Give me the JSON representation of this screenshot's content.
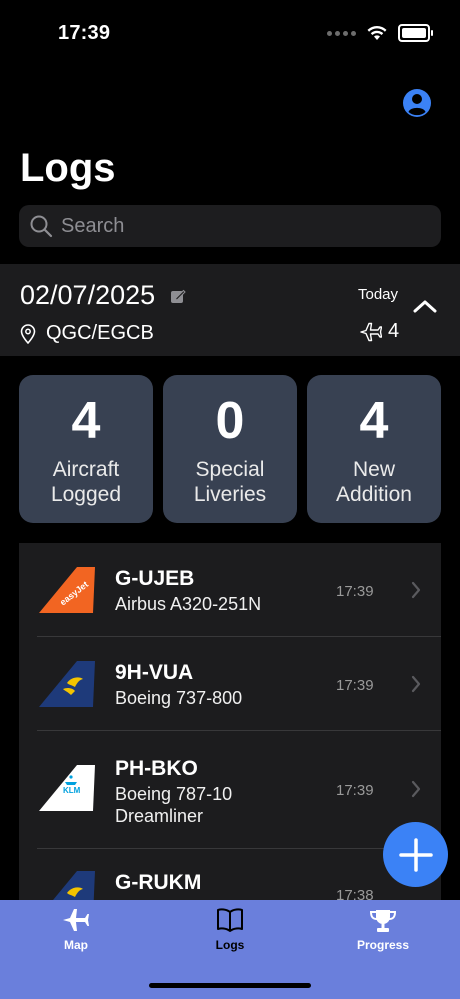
{
  "status_bar": {
    "time": "17:39"
  },
  "header": {
    "title": "Logs"
  },
  "search": {
    "placeholder": "Search"
  },
  "session": {
    "date": "02/07/2025",
    "location": "QGC/EGCB",
    "day_label": "Today",
    "aircraft_count": "4"
  },
  "stats": [
    {
      "value": "4",
      "label_line1": "Aircraft",
      "label_line2": "Logged"
    },
    {
      "value": "0",
      "label_line1": "Special",
      "label_line2": "Liveries"
    },
    {
      "value": "4",
      "label_line1": "New",
      "label_line2": "Addition"
    }
  ],
  "aircraft": [
    {
      "registration": "G-UJEB",
      "model": "Airbus A320-251N",
      "time": "17:39",
      "airline_logo": "easyjet-tail-icon",
      "logo_text": "easyJet"
    },
    {
      "registration": "9H-VUA",
      "model": "Boeing 737-800",
      "time": "17:39",
      "airline_logo": "ryanair-tail-icon"
    },
    {
      "registration": "PH-BKO",
      "model": "Boeing 787-10 Dreamliner",
      "time": "17:39",
      "airline_logo": "klm-tail-icon",
      "logo_text": "KLM"
    },
    {
      "registration": "G-RUKM",
      "model": "",
      "time": "17:38",
      "airline_logo": "ryanair-tail-icon"
    }
  ],
  "tabs": [
    {
      "label": "Map",
      "icon": "airplane-icon"
    },
    {
      "label": "Logs",
      "icon": "book-icon"
    },
    {
      "label": "Progress",
      "icon": "trophy-icon"
    }
  ],
  "colors": {
    "accent": "#3b82f6",
    "tabbar": "#6a7fdc",
    "card": "#384152",
    "easyjet": "#f26522",
    "ryanair": "#1e3a7a"
  }
}
